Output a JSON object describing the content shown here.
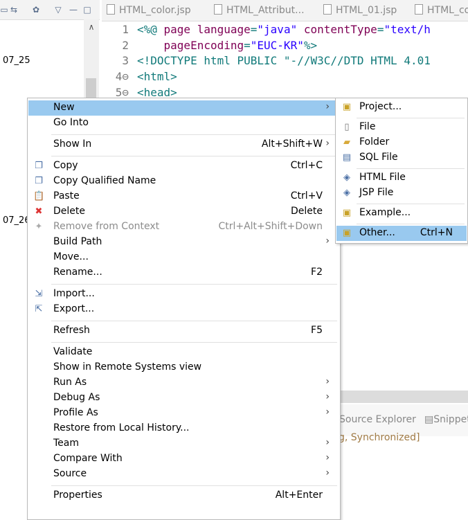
{
  "editor": {
    "tabs": [
      "HTML_color.jsp",
      "HTML_Attribut...",
      "HTML_01.jsp",
      "HTML_co"
    ],
    "lines": [
      {
        "num": "1",
        "parts": [
          [
            "tag",
            "<%@ "
          ],
          [
            "attr",
            "page language"
          ],
          [
            "tag",
            "="
          ],
          [
            "str",
            "\"java\""
          ],
          [
            "tag",
            " "
          ],
          [
            "attr",
            "contentType"
          ],
          [
            "tag",
            "="
          ],
          [
            "str",
            "\"text/h"
          ]
        ]
      },
      {
        "num": "2",
        "parts": [
          [
            "tag",
            "    "
          ],
          [
            "attr",
            "pageEncoding"
          ],
          [
            "tag",
            "="
          ],
          [
            "str",
            "\"EUC-KR\""
          ],
          [
            "tag",
            "%>"
          ]
        ]
      },
      {
        "num": "3",
        "parts": [
          [
            "tag",
            "<!DOCTYPE html PUBLIC \"-//W3C//DTD HTML 4.01"
          ]
        ]
      },
      {
        "num": "4⊖",
        "parts": [
          [
            "tag",
            "<html>"
          ]
        ]
      },
      {
        "num": "5⊖",
        "parts": [
          [
            "tag",
            "<head>"
          ]
        ]
      }
    ]
  },
  "explorer": {
    "items": [
      "07_25",
      "07_26"
    ]
  },
  "bottom": {
    "tabs": [
      "Source Explorer",
      "Snippet"
    ],
    "status": "g, Synchronized]"
  },
  "context_menu": {
    "items": [
      {
        "label": "New",
        "accel": "",
        "submenu": true,
        "icon": "",
        "disabled": false,
        "selected": true
      },
      {
        "label": "Go Into",
        "accel": "",
        "submenu": false,
        "icon": "",
        "disabled": false
      },
      {
        "sep": true
      },
      {
        "label": "Show In",
        "accel": "Alt+Shift+W",
        "submenu": true,
        "icon": "",
        "disabled": false
      },
      {
        "sep": true
      },
      {
        "label": "Copy",
        "accel": "Ctrl+C",
        "submenu": false,
        "icon": "copy-icon",
        "disabled": false
      },
      {
        "label": "Copy Qualified Name",
        "accel": "",
        "submenu": false,
        "icon": "copy-qualified-icon",
        "disabled": false
      },
      {
        "label": "Paste",
        "accel": "Ctrl+V",
        "submenu": false,
        "icon": "paste-icon",
        "disabled": false
      },
      {
        "label": "Delete",
        "accel": "Delete",
        "submenu": false,
        "icon": "delete-icon",
        "disabled": false
      },
      {
        "label": "Remove from Context",
        "accel": "Ctrl+Alt+Shift+Down",
        "submenu": false,
        "icon": "remove-context-icon",
        "disabled": true
      },
      {
        "label": "Build Path",
        "accel": "",
        "submenu": true,
        "icon": "",
        "disabled": false
      },
      {
        "label": "Move...",
        "accel": "",
        "submenu": false,
        "icon": "",
        "disabled": false
      },
      {
        "label": "Rename...",
        "accel": "F2",
        "submenu": false,
        "icon": "",
        "disabled": false
      },
      {
        "sep": true
      },
      {
        "label": "Import...",
        "accel": "",
        "submenu": false,
        "icon": "import-icon",
        "disabled": false
      },
      {
        "label": "Export...",
        "accel": "",
        "submenu": false,
        "icon": "export-icon",
        "disabled": false
      },
      {
        "sep": true
      },
      {
        "label": "Refresh",
        "accel": "F5",
        "submenu": false,
        "icon": "",
        "disabled": false
      },
      {
        "sep": true
      },
      {
        "label": "Validate",
        "accel": "",
        "submenu": false,
        "icon": "",
        "disabled": false
      },
      {
        "label": "Show in Remote Systems view",
        "accel": "",
        "submenu": false,
        "icon": "",
        "disabled": false
      },
      {
        "label": "Run As",
        "accel": "",
        "submenu": true,
        "icon": "",
        "disabled": false
      },
      {
        "label": "Debug As",
        "accel": "",
        "submenu": true,
        "icon": "",
        "disabled": false
      },
      {
        "label": "Profile As",
        "accel": "",
        "submenu": true,
        "icon": "",
        "disabled": false
      },
      {
        "label": "Restore from Local History...",
        "accel": "",
        "submenu": false,
        "icon": "",
        "disabled": false
      },
      {
        "label": "Team",
        "accel": "",
        "submenu": true,
        "icon": "",
        "disabled": false
      },
      {
        "label": "Compare With",
        "accel": "",
        "submenu": true,
        "icon": "",
        "disabled": false
      },
      {
        "label": "Source",
        "accel": "",
        "submenu": true,
        "icon": "",
        "disabled": false
      },
      {
        "sep": true
      },
      {
        "label": "Properties",
        "accel": "Alt+Enter",
        "submenu": false,
        "icon": "",
        "disabled": false
      }
    ]
  },
  "submenu": {
    "items": [
      {
        "label": "Project...",
        "accel": "",
        "icon": "project-icon"
      },
      {
        "sep": true
      },
      {
        "label": "File",
        "accel": "",
        "icon": "file-icon"
      },
      {
        "label": "Folder",
        "accel": "",
        "icon": "folder-icon"
      },
      {
        "label": "SQL File",
        "accel": "",
        "icon": "sql-file-icon"
      },
      {
        "sep": true
      },
      {
        "label": "HTML File",
        "accel": "",
        "icon": "html-file-icon"
      },
      {
        "label": "JSP File",
        "accel": "",
        "icon": "jsp-file-icon"
      },
      {
        "sep": true
      },
      {
        "label": "Example...",
        "accel": "",
        "icon": "example-icon"
      },
      {
        "sep": true
      },
      {
        "label": "Other...",
        "accel": "Ctrl+N",
        "icon": "other-icon",
        "selected": true
      }
    ]
  },
  "colors": {
    "selection": "#99c9ef",
    "tag": "#117a7a",
    "attr": "#7f0055",
    "string": "#2a00ff"
  }
}
